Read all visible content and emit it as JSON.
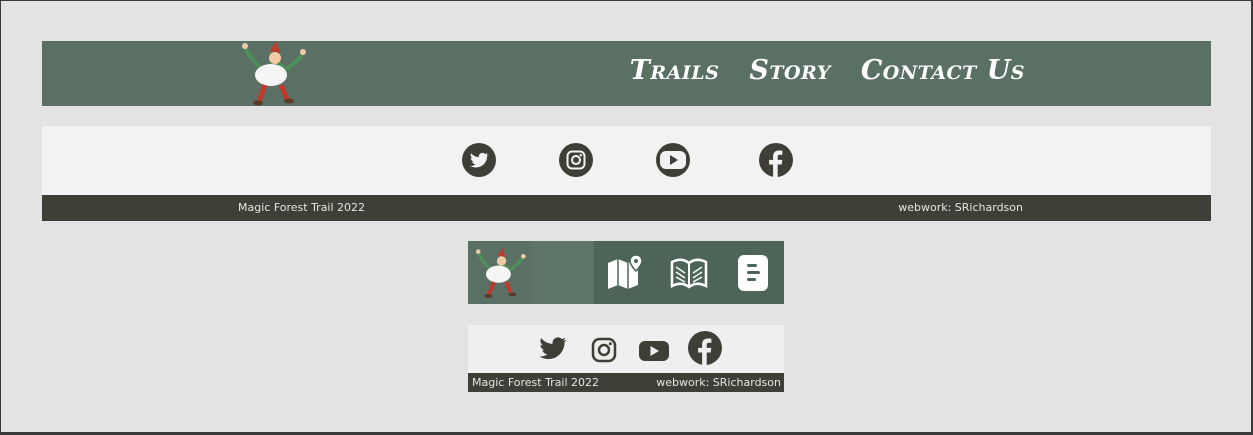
{
  "nav": {
    "links": [
      "Trails",
      "Story",
      "Contact Us"
    ]
  },
  "social": {
    "icons": [
      "twitter-icon",
      "instagram-icon",
      "youtube-icon",
      "facebook-icon"
    ]
  },
  "footer": {
    "left": "Magic Forest Trail 2022",
    "right": "webwork: SRichardson"
  },
  "mobile_nav": {
    "icons": [
      "map-icon",
      "book-icon",
      "contact-card-icon"
    ]
  },
  "colors": {
    "header": "#5a7064",
    "mobile_header": "#4c6558",
    "footer": "#3f3e37",
    "social_bg": "#f2f2f2",
    "icon_dark": "#3f3e37",
    "page_bg": "#e3e3e3"
  }
}
